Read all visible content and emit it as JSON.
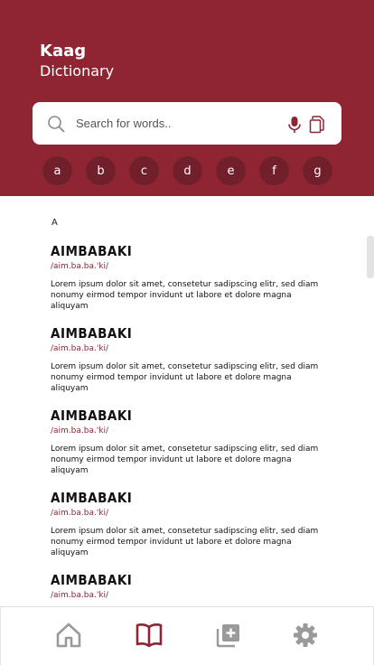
{
  "app": {
    "title_line1": "Kaag",
    "title_line2": "Dictionary"
  },
  "search": {
    "placeholder": "Search for words..",
    "value": ""
  },
  "letters": [
    "a",
    "b",
    "c",
    "d",
    "e",
    "f",
    "g"
  ],
  "section_label": "A",
  "entries": [
    {
      "word": "AiMBABAKi",
      "pronunciation": "/aim.ba.ba.'ki/",
      "definition": "Lorem ipsum dolor sit amet, consetetur sadipscing elitr, sed diam nonumy eirmod tempor invidunt ut labore et dolore magna aliquyam"
    },
    {
      "word": "AiMBABAKi",
      "pronunciation": "/aim.ba.ba.'ki/",
      "definition": "Lorem ipsum dolor sit amet, consetetur sadipscing elitr, sed diam nonumy eirmod tempor invidunt ut labore et dolore magna aliquyam"
    },
    {
      "word": "AiMBABAKi",
      "pronunciation": "/aim.ba.ba.'ki/",
      "definition": "Lorem ipsum dolor sit amet, consetetur sadipscing elitr, sed diam nonumy eirmod tempor invidunt ut labore et dolore magna aliquyam"
    },
    {
      "word": "AiMBABAKi",
      "pronunciation": "/aim.ba.ba.'ki/",
      "definition": "Lorem ipsum dolor sit amet, consetetur sadipscing elitr, sed diam nonumy eirmod tempor invidunt ut labore et dolore magna aliquyam"
    },
    {
      "word": "AiMBABAKi",
      "pronunciation": "/aim.ba.ba.'ki/",
      "definition": ""
    }
  ],
  "nav": {
    "items": [
      {
        "icon": "home-icon",
        "active": false
      },
      {
        "icon": "book-icon",
        "active": true
      },
      {
        "icon": "add-to-collection-icon",
        "active": false
      },
      {
        "icon": "gear-icon",
        "active": false
      }
    ]
  },
  "colors": {
    "brand": "#8f2533",
    "letter_bubble": "#71202b",
    "nav_inactive": "#9a9a9a",
    "nav_active": "#8f2533"
  }
}
